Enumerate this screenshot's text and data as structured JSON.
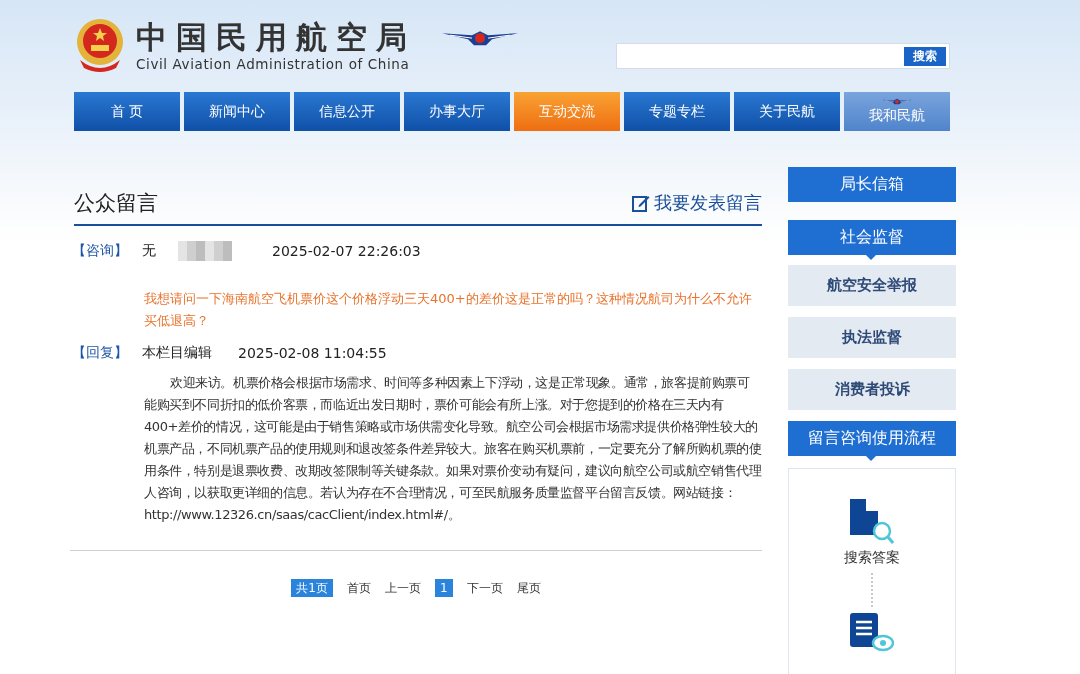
{
  "header": {
    "title_cn": "中国民用航空局",
    "title_en": "Civil Aviation Administration of China"
  },
  "search": {
    "button": "搜索"
  },
  "nav": [
    {
      "label": "首 页",
      "selected": false,
      "kind": "plain"
    },
    {
      "label": "新闻中心",
      "selected": false,
      "kind": "plain"
    },
    {
      "label": "信息公开",
      "selected": false,
      "kind": "plain"
    },
    {
      "label": "办事大厅",
      "selected": false,
      "kind": "plain"
    },
    {
      "label": "互动交流",
      "selected": true,
      "kind": "plain"
    },
    {
      "label": "专题专栏",
      "selected": false,
      "kind": "plain"
    },
    {
      "label": "关于民航",
      "selected": false,
      "kind": "plain"
    },
    {
      "label": "我和民航",
      "selected": false,
      "kind": "wings"
    }
  ],
  "page": {
    "title": "公众留言",
    "post_link": "我要发表留言"
  },
  "consult": {
    "tag": "【咨询】",
    "name": "无",
    "time": "2025-02-07 22:26:03",
    "question": "我想请问一下海南航空飞机票价这个价格浮动三天400+的差价这是正常的吗？这种情况航司为什么不允许买低退高？"
  },
  "reply": {
    "tag": "【回复】",
    "author": "本栏目编辑",
    "time": "2025-02-08 11:04:55",
    "body": "欢迎来访。机票价格会根据市场需求、时间等多种因素上下浮动，这是正常现象。通常，旅客提前购票可能购买到不同折扣的低价客票，而临近出发日期时，票价可能会有所上涨。对于您提到的价格在三天内有400+差价的情况，这可能是由于销售策略或市场供需变化导致。航空公司会根据市场需求提供价格弹性较大的机票产品，不同机票产品的使用规则和退改签条件差异较大。旅客在购买机票前，一定要充分了解所购机票的使用条件，特别是退票收费、改期改签限制等关键条款。如果对票价变动有疑问，建议向航空公司或航空销售代理人咨询，以获取更详细的信息。若认为存在不合理情况，可至民航服务质量监督平台留言反馈。网站链接：",
    "link": "http://www.12326.cn/saas/cacClient/index.html#/。"
  },
  "pagination": [
    {
      "label": "共1页",
      "kind": "count"
    },
    {
      "label": "首页",
      "kind": "link",
      "selected": false
    },
    {
      "label": "上一页",
      "kind": "link",
      "selected": false
    },
    {
      "label": "1",
      "kind": "page",
      "selected": true
    },
    {
      "label": "下一页",
      "kind": "link",
      "selected": false
    },
    {
      "label": "尾页",
      "kind": "link",
      "selected": false
    }
  ],
  "sidebar": [
    {
      "label": "局长信箱",
      "kind": "header"
    },
    {
      "label": "社会监督",
      "kind": "section"
    },
    {
      "label": "航空安全举报",
      "kind": "link"
    },
    {
      "label": "执法监督",
      "kind": "link"
    },
    {
      "label": "消费者投诉",
      "kind": "link"
    },
    {
      "label": "留言咨询使用流程",
      "kind": "section"
    }
  ],
  "process": [
    {
      "label": "搜索答案"
    }
  ]
}
